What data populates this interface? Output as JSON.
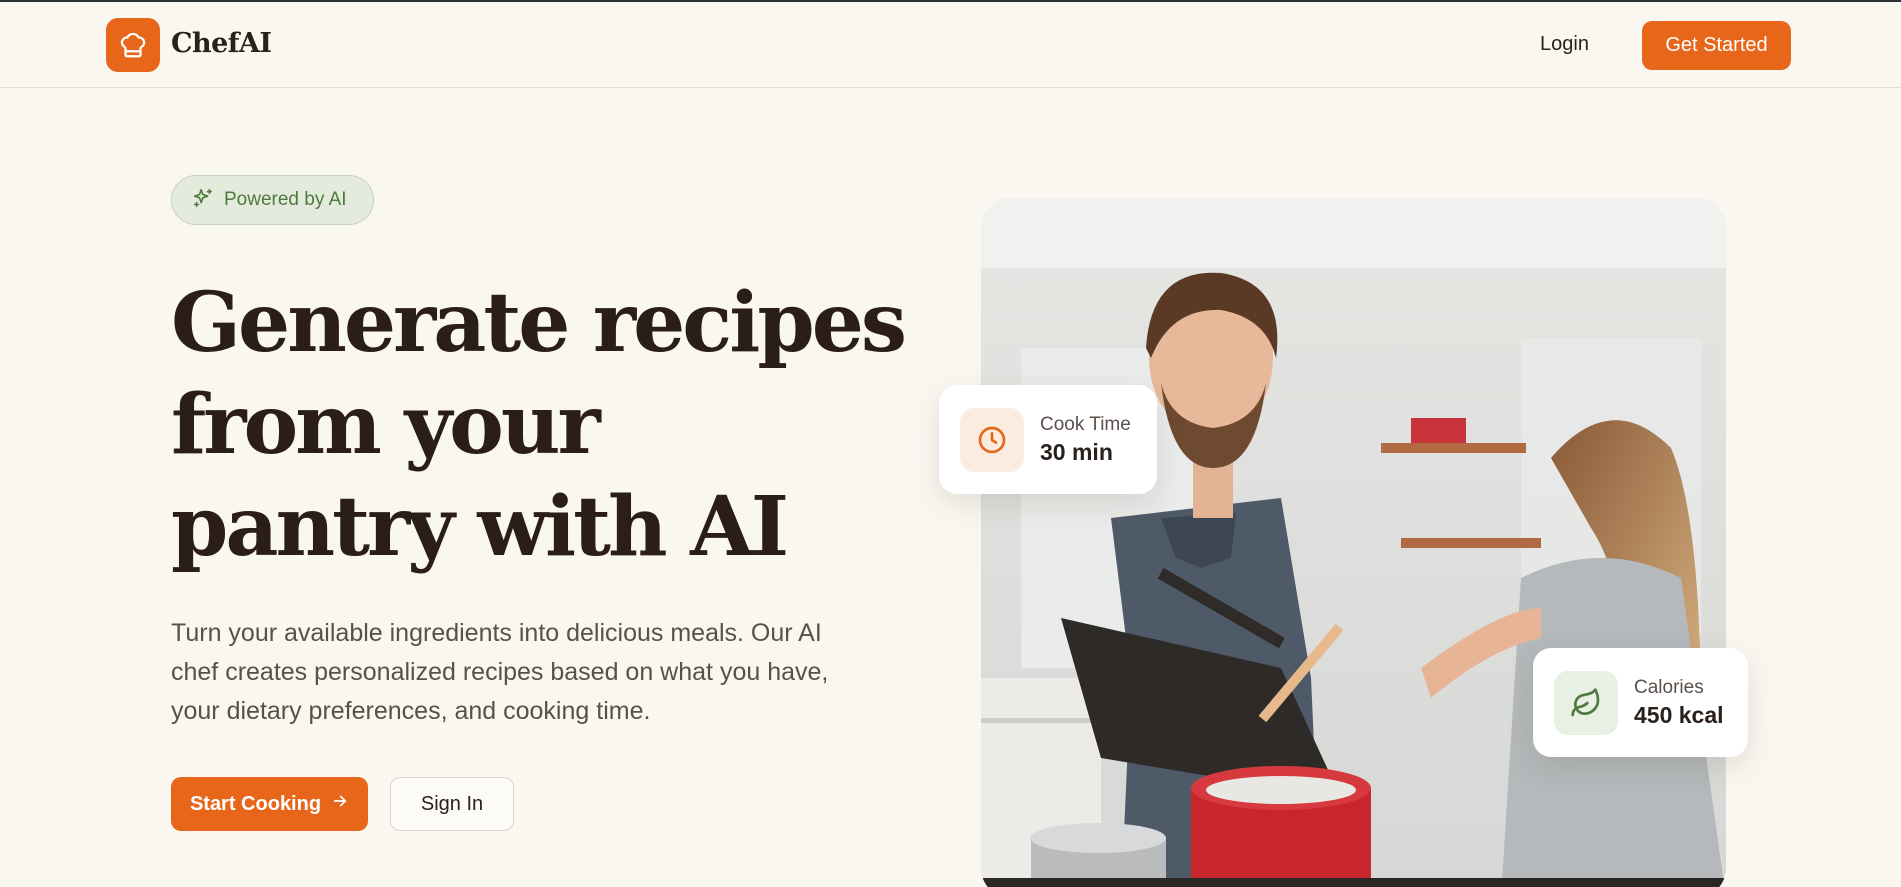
{
  "nav": {
    "brand": "ChefAI",
    "login_label": "Login",
    "cta_label": "Get Started"
  },
  "hero": {
    "badge": "Powered by AI",
    "headline_lines": [
      "Generate recipes",
      "from your",
      "pantry with AI"
    ],
    "subtext": "Turn your available ingredients into delicious meals. Our AI chef creates personalized recipes based on what you have, your dietary preferences, and cooking time.",
    "primary_button": "Start Cooking",
    "secondary_button": "Sign In"
  },
  "cards": {
    "cook_time": {
      "label": "Cook Time",
      "value": "30 min",
      "icon": "clock-icon"
    },
    "calories": {
      "label": "Calories",
      "value": "450 kcal",
      "icon": "leaf-icon"
    }
  },
  "colors": {
    "accent": "#e8661a",
    "background": "#faf7f1",
    "badge_green": "#4d7a3f",
    "text_dark": "#2b1d17"
  },
  "icons": {
    "logo": "chef-hat-icon",
    "badge": "sparkles-icon",
    "button": "arrow-right-icon"
  }
}
